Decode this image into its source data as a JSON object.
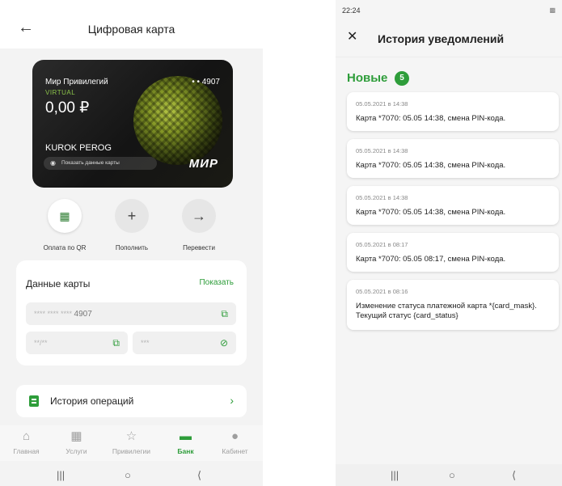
{
  "left": {
    "header": {
      "back_icon": "arrow-left-icon",
      "title": "Цифровая карта"
    },
    "card": {
      "name": "Мир Привилегий",
      "type": "VIRTUAL",
      "balance": "0,00 ₽",
      "last_digits": "• • 4907",
      "holder": "KUROK PEROG",
      "show_label": "Показать данные карты",
      "brand": "МИР"
    },
    "actions": [
      {
        "label": "Оплата по QR",
        "icon": "qr-icon"
      },
      {
        "label": "Пополнить",
        "icon": "plus-icon"
      },
      {
        "label": "Перевести",
        "icon": "arrow-right-icon"
      }
    ],
    "card_data": {
      "title": "Данные карты",
      "show": "Показать",
      "number_mask": "**** **** ****",
      "number_last": "4907",
      "expiry_mask": "**/**",
      "cvv_mask": "***"
    },
    "history": {
      "label": "История операций"
    },
    "nav": [
      {
        "label": "Главная",
        "icon": "home-icon"
      },
      {
        "label": "Услуги",
        "icon": "grid-icon"
      },
      {
        "label": "Привилегии",
        "icon": "star-icon"
      },
      {
        "label": "Банк",
        "icon": "card-icon",
        "active": true
      },
      {
        "label": "Кабинет",
        "icon": "user-icon"
      }
    ]
  },
  "right": {
    "status": {
      "time": "22:24"
    },
    "header": {
      "close_icon": "close-icon",
      "title": "История уведомлений"
    },
    "section": {
      "label": "Новые",
      "count": "5"
    },
    "notifications": [
      {
        "date": "05.05.2021 в 14:38",
        "text": "Карта *7070: 05.05 14:38, смена PIN-кода."
      },
      {
        "date": "05.05.2021 в 14:38",
        "text": "Карта *7070: 05.05 14:38, смена PIN-кода."
      },
      {
        "date": "05.05.2021 в 14:38",
        "text": "Карта *7070: 05.05 14:38, смена PIN-кода."
      },
      {
        "date": "05.05.2021 в 08:17",
        "text": "Карта *7070: 05.05 08:17, смена PIN-кода."
      },
      {
        "date": "05.05.2021 в 08:16",
        "text": "Изменение статуса платежной карта *{card_mask}. Текущий статус {card_status}"
      }
    ]
  },
  "colors": {
    "accent": "#2e9d3a",
    "card_bg": "#1a1a1a",
    "card_globe": "#a8c030"
  }
}
